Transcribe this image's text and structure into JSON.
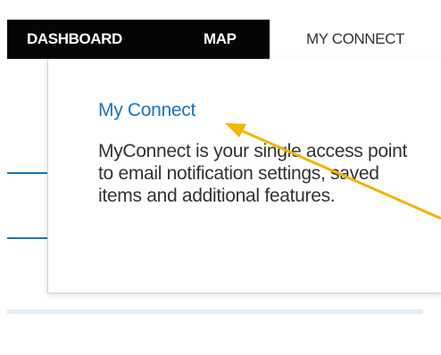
{
  "nav": {
    "tabs": [
      {
        "label": "DASHBOARD",
        "active": false
      },
      {
        "label": "MAP",
        "active": false
      },
      {
        "label": "MY CONNECT",
        "active": true
      }
    ]
  },
  "popover": {
    "title": "My Connect",
    "description": "MyConnect is your single access point to email notification settings, saved items and additional features."
  },
  "colors": {
    "nav_background": "#050505",
    "link_blue": "#1b75bb",
    "annotation_arrow": "#f4b400",
    "text": "#333333"
  }
}
